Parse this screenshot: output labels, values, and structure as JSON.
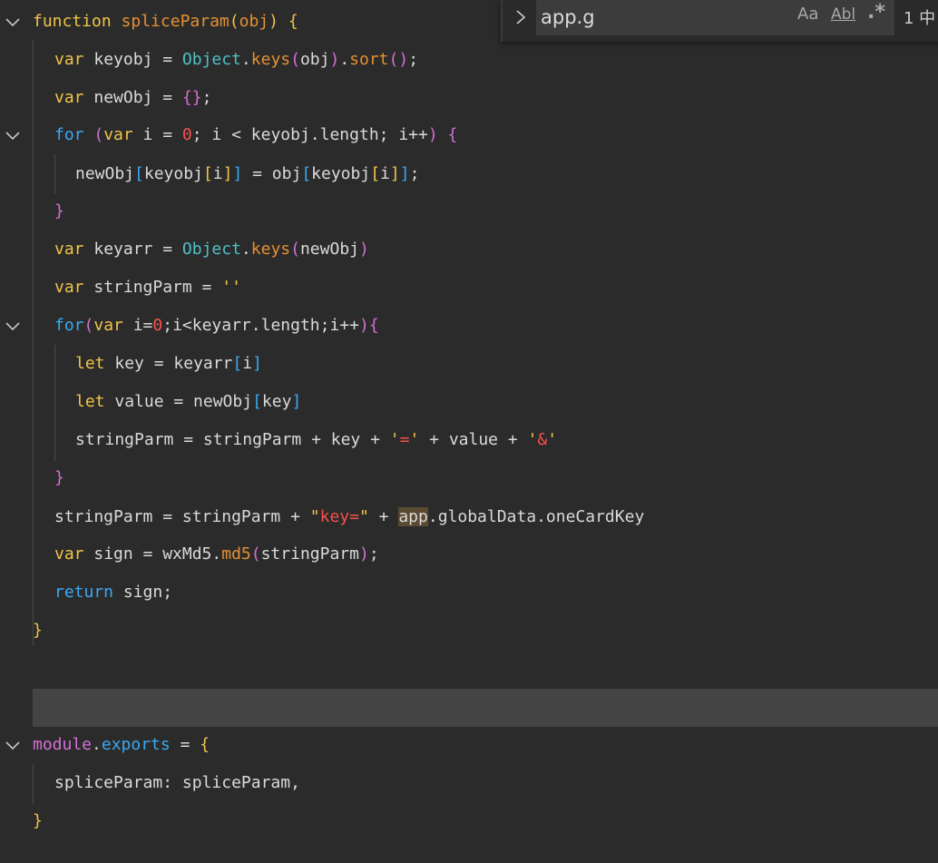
{
  "editor": {
    "lines": [
      {
        "fold": true,
        "tokens": [
          [
            "function",
            "kw"
          ],
          [
            " ",
            ""
          ],
          [
            "spliceParam",
            "fn"
          ],
          [
            "(",
            "p1"
          ],
          [
            "obj",
            "fn"
          ],
          [
            ")",
            "p1"
          ],
          [
            " ",
            ""
          ],
          [
            "{",
            "p1"
          ]
        ]
      },
      {
        "fold": false,
        "tokens": [
          [
            "var",
            "kw"
          ],
          [
            " keyobj = ",
            ""
          ],
          [
            "Object",
            "obj"
          ],
          [
            ".",
            ""
          ],
          [
            "keys",
            "fn"
          ],
          [
            "(",
            "p2"
          ],
          [
            "obj",
            ""
          ],
          [
            ")",
            "p2"
          ],
          [
            ".",
            ""
          ],
          [
            "sort",
            "fn"
          ],
          [
            "()",
            "p2"
          ],
          [
            ";",
            ""
          ]
        ]
      },
      {
        "fold": false,
        "tokens": [
          [
            "var",
            "kw"
          ],
          [
            " newObj = ",
            ""
          ],
          [
            "{}",
            "p2"
          ],
          [
            ";",
            ""
          ]
        ]
      },
      {
        "fold": true,
        "tokens": [
          [
            "for",
            "ctl"
          ],
          [
            " ",
            ""
          ],
          [
            "(",
            "p2"
          ],
          [
            "var",
            "kw"
          ],
          [
            " i = ",
            ""
          ],
          [
            "0",
            "num"
          ],
          [
            "; i < keyobj.length; i++",
            ""
          ],
          [
            ")",
            "p2"
          ],
          [
            " ",
            ""
          ],
          [
            "{",
            "p2"
          ]
        ]
      },
      {
        "fold": false,
        "tokens": [
          [
            "newObj",
            ""
          ],
          [
            "[",
            "p3"
          ],
          [
            "keyobj",
            ""
          ],
          [
            "[",
            "p1"
          ],
          [
            "i",
            ""
          ],
          [
            "]",
            "p1"
          ],
          [
            "]",
            "p3"
          ],
          [
            " = obj",
            ""
          ],
          [
            "[",
            "p3"
          ],
          [
            "keyobj",
            ""
          ],
          [
            "[",
            "p1"
          ],
          [
            "i",
            ""
          ],
          [
            "]",
            "p1"
          ],
          [
            "]",
            "p3"
          ],
          [
            ";",
            ""
          ]
        ]
      },
      {
        "fold": false,
        "tokens": [
          [
            "}",
            "p2"
          ]
        ]
      },
      {
        "fold": false,
        "tokens": [
          [
            "var",
            "kw"
          ],
          [
            " keyarr = ",
            ""
          ],
          [
            "Object",
            "obj"
          ],
          [
            ".",
            ""
          ],
          [
            "keys",
            "fn"
          ],
          [
            "(",
            "p2"
          ],
          [
            "newObj",
            ""
          ],
          [
            ")",
            "p2"
          ]
        ]
      },
      {
        "fold": false,
        "tokens": [
          [
            "var",
            "kw"
          ],
          [
            " stringParm = ",
            ""
          ],
          [
            "''",
            "str"
          ]
        ]
      },
      {
        "fold": true,
        "tokens": [
          [
            "for",
            "ctl"
          ],
          [
            "(",
            "p2"
          ],
          [
            "var",
            "kw"
          ],
          [
            " i=",
            ""
          ],
          [
            "0",
            "num"
          ],
          [
            ";i<keyarr.length;i++",
            ""
          ],
          [
            ")",
            "p2"
          ],
          [
            "{",
            "p2"
          ]
        ]
      },
      {
        "fold": false,
        "tokens": [
          [
            "let",
            "kw"
          ],
          [
            " key = keyarr",
            ""
          ],
          [
            "[",
            "p3"
          ],
          [
            "i",
            ""
          ],
          [
            "]",
            "p3"
          ]
        ]
      },
      {
        "fold": false,
        "tokens": [
          [
            "let",
            "kw"
          ],
          [
            " value = newObj",
            ""
          ],
          [
            "[",
            "p3"
          ],
          [
            "key",
            ""
          ],
          [
            "]",
            "p3"
          ]
        ]
      },
      {
        "fold": false,
        "tokens": [
          [
            "stringParm = stringParm + key + ",
            ""
          ],
          [
            "'",
            "str"
          ],
          [
            "=",
            "str2"
          ],
          [
            "'",
            "str"
          ],
          [
            " + value + ",
            ""
          ],
          [
            "'",
            "str"
          ],
          [
            "&",
            "str2"
          ],
          [
            "'",
            "str"
          ]
        ]
      },
      {
        "fold": false,
        "tokens": [
          [
            "}",
            "p2"
          ]
        ]
      },
      {
        "fold": false,
        "tokens": [
          [
            "stringParm = stringParm + ",
            ""
          ],
          [
            "\"",
            "str"
          ],
          [
            "key=",
            "str2"
          ],
          [
            "\"",
            "str"
          ],
          [
            " + ",
            ""
          ],
          [
            "app",
            ""
          ],
          [
            ".",
            ""
          ],
          [
            "globalData",
            ""
          ],
          [
            ".",
            ""
          ],
          [
            "oneCardKey",
            ""
          ]
        ]
      },
      {
        "fold": false,
        "tokens": [
          [
            "var",
            "kw"
          ],
          [
            " sign = wxMd5.",
            ""
          ],
          [
            "md5",
            "fn"
          ],
          [
            "(",
            "p2"
          ],
          [
            "stringParm",
            ""
          ],
          [
            ")",
            "p2"
          ],
          [
            ";",
            ""
          ]
        ]
      },
      {
        "fold": false,
        "tokens": [
          [
            "return",
            "ctl"
          ],
          [
            " sign;",
            ""
          ]
        ]
      },
      {
        "fold": false,
        "tokens": [
          [
            "}",
            "p1"
          ]
        ]
      },
      {
        "fold": false,
        "tokens": []
      },
      {
        "fold": false,
        "tokens": []
      },
      {
        "fold": true,
        "tokens": [
          [
            "module",
            "p2"
          ],
          [
            ".",
            ""
          ],
          [
            "exports",
            "p3"
          ],
          [
            " = ",
            ""
          ],
          [
            "{",
            "p1"
          ]
        ]
      },
      {
        "fold": false,
        "tokens": [
          [
            "spliceParam: spliceParam,",
            ""
          ]
        ]
      },
      {
        "fold": false,
        "tokens": [
          [
            "}",
            "p1"
          ]
        ]
      }
    ]
  },
  "find_widget": {
    "query": "app.g",
    "match_case_label": "Aa",
    "whole_word_label": "Abl",
    "regex_label": ".*",
    "result_text": "1 中"
  }
}
